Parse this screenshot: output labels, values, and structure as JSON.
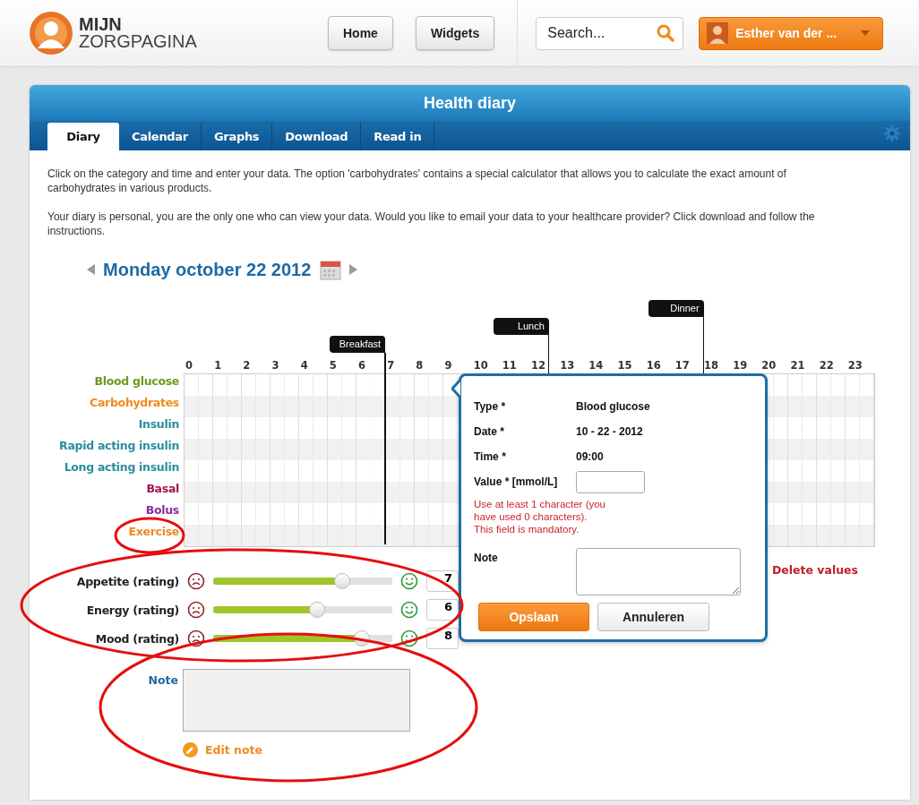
{
  "header": {
    "logo": {
      "line1": "MIJN",
      "line2": "ZORGPAGINA"
    },
    "nav": [
      "Home",
      "Widgets"
    ],
    "search": {
      "placeholder": "Search..."
    },
    "user": {
      "name": "Esther van der ..."
    }
  },
  "card": {
    "title": "Health diary",
    "tabs": [
      {
        "label": "Diary",
        "selected": true
      },
      {
        "label": "Calendar",
        "selected": false
      },
      {
        "label": "Graphs",
        "selected": false
      },
      {
        "label": "Download",
        "selected": false
      },
      {
        "label": "Read in",
        "selected": false
      }
    ],
    "intro": [
      "Click on the category and time and enter your data. The option 'carbohydrates' contains a special calculator that allows you to calculate the exact amount of carbohydrates in various products.",
      "Your diary is personal, you are the only one who can view your data. Would you like to email your data to your healthcare provider? Click download and follow the instructions."
    ],
    "date": "Monday october 22 2012",
    "hours": [
      "0",
      "1",
      "2",
      "3",
      "4",
      "5",
      "6",
      "7",
      "8",
      "9",
      "10",
      "11",
      "12",
      "13",
      "14",
      "15",
      "16",
      "17",
      "18",
      "19",
      "20",
      "21",
      "22",
      "23"
    ],
    "meals": [
      {
        "label": "Breakfast"
      },
      {
        "label": "Lunch"
      },
      {
        "label": "Dinner"
      }
    ],
    "categories": [
      {
        "label": "Blood glucose",
        "color": "#6b9a1f"
      },
      {
        "label": "Carbohydrates",
        "color": "#ef8a1e"
      },
      {
        "label": "Insulin",
        "color": "#2a8e9e"
      },
      {
        "label": "Rapid acting insulin",
        "color": "#2a8e9e"
      },
      {
        "label": "Long acting insulin",
        "color": "#2a8e9e"
      },
      {
        "label": "Basal",
        "color": "#a3154f"
      },
      {
        "label": "Bolus",
        "color": "#8a2c9e"
      },
      {
        "label": "Exercise",
        "color": "#ef8a1e"
      }
    ],
    "delete_link": "Delete values",
    "ratings": [
      {
        "label": "Appetite (rating)",
        "level": 0.72,
        "value": "7"
      },
      {
        "label": "Energy (rating)",
        "level": 0.58,
        "value": "6"
      },
      {
        "label": "Mood (rating)",
        "level": 0.83,
        "value": "8"
      }
    ],
    "note": {
      "label": "Note",
      "edit": "Edit note"
    },
    "popup": {
      "fields": [
        {
          "label": "Type *",
          "kind": "text",
          "value": "Blood glucose"
        },
        {
          "label": "Date *",
          "kind": "text",
          "value": "10 - 22 - 2012"
        },
        {
          "label": "Time *",
          "kind": "text",
          "value": "09:00"
        },
        {
          "label": "Value * [mmol/L]",
          "kind": "input"
        }
      ],
      "errors": [
        "Use at least 1 character (you have used 0 characters).",
        "This field is mandatory."
      ],
      "note_label": "Note",
      "save": "Opslaan",
      "cancel": "Annuleren"
    }
  }
}
